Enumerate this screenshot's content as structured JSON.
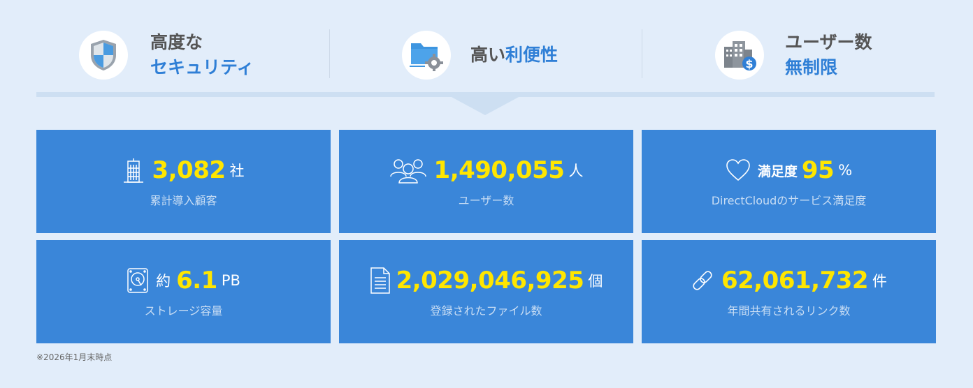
{
  "features": [
    {
      "line1": "高度な",
      "line2": "セキュリティ",
      "icon": "shield-icon"
    },
    {
      "prefix": "高い",
      "highlight": "利便性",
      "icon": "folder-gear-icon"
    },
    {
      "line1": "ユーザー数",
      "line2": "無制限",
      "icon": "buildings-dollar-icon"
    }
  ],
  "stats": [
    {
      "value": "3,082",
      "unit": "社",
      "label": "累計導入顧客",
      "icon": "building-icon"
    },
    {
      "value": "1,490,055",
      "unit": "人",
      "label": "ユーザー数",
      "icon": "users-icon"
    },
    {
      "prefix": "満足度",
      "value": "95",
      "unit": "%",
      "label": "DirectCloudのサービス満足度",
      "icon": "heart-icon"
    },
    {
      "prefix": "約",
      "value": "6.1",
      "unit": "PB",
      "label": "ストレージ容量",
      "icon": "hard-drive-icon"
    },
    {
      "value": "2,029,046,925",
      "unit": "個",
      "label": "登録されたファイル数",
      "icon": "document-icon"
    },
    {
      "value": "62,061,732",
      "unit": "件",
      "label": "年間共有されるリンク数",
      "icon": "link-icon"
    }
  ],
  "note": "※2026年1月末時点",
  "colors": {
    "accent": "#2f7fd6",
    "card": "#3a86d9",
    "highlight": "#ffe600",
    "background": "#e2edfa"
  }
}
